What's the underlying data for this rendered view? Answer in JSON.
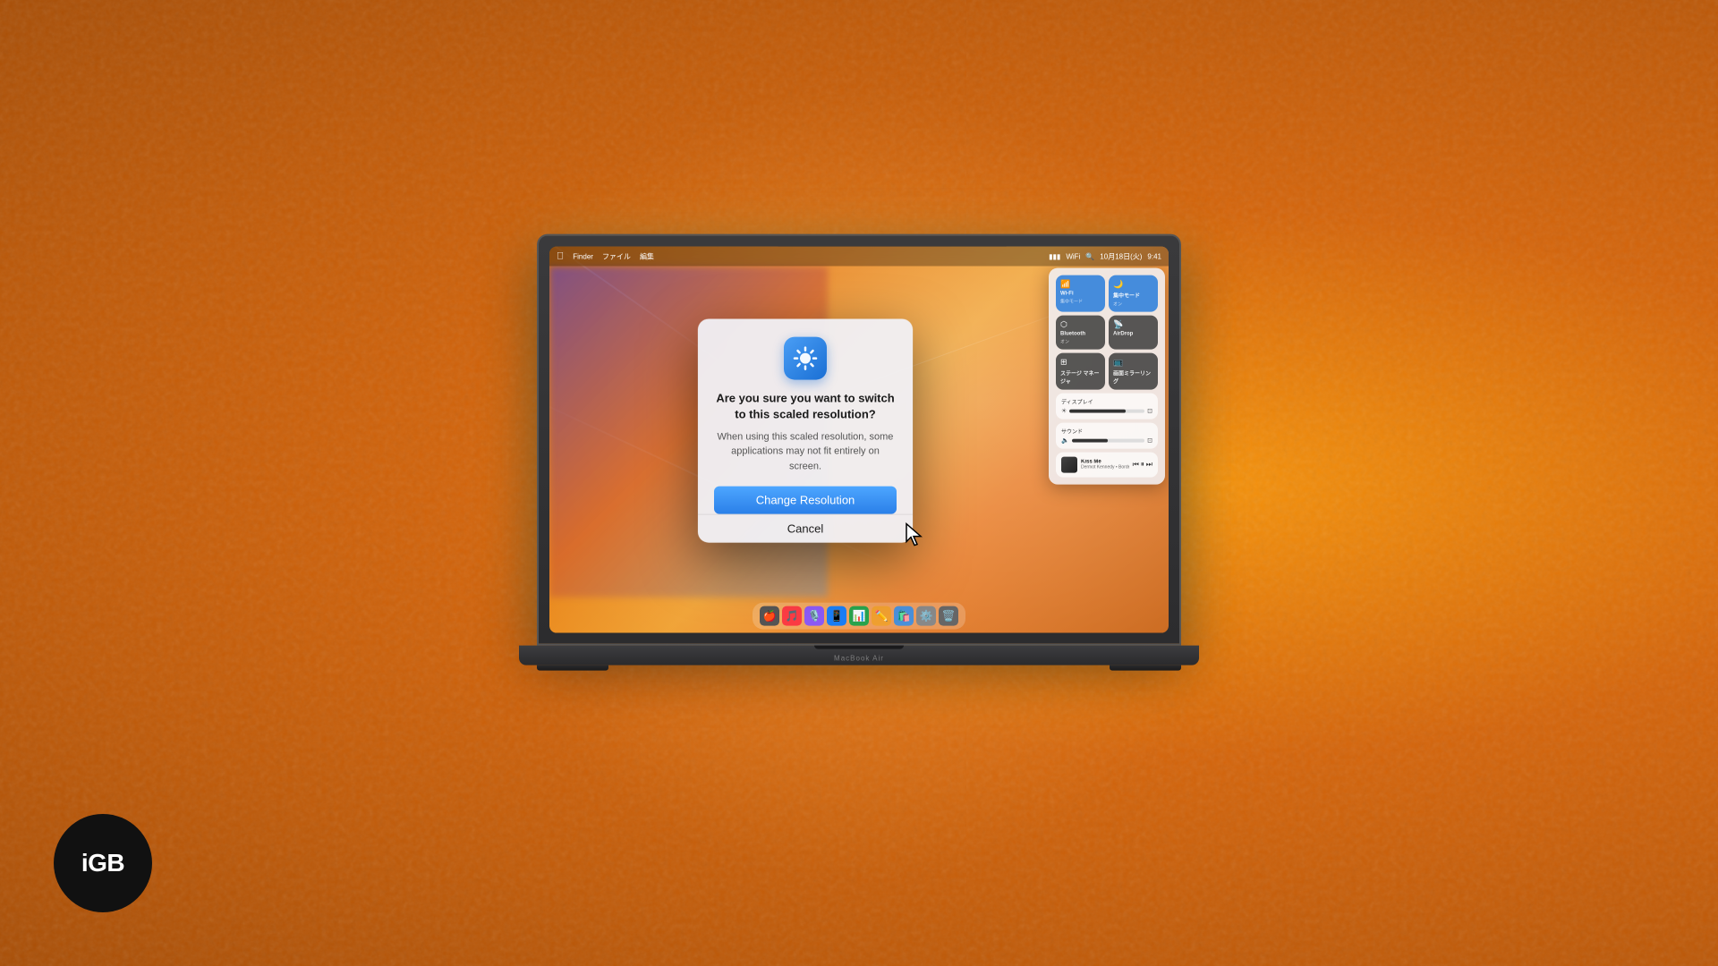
{
  "background": {
    "color_left": "#C86010",
    "color_right": "#F09030"
  },
  "igb_logo": {
    "text": "iGB"
  },
  "macbook": {
    "model_name": "MacBook Air"
  },
  "menubar": {
    "apple": "⌘",
    "time": "9:41",
    "date": "10月18日(火)"
  },
  "dialog": {
    "icon_alt": "Display Settings Icon",
    "title": "Are you sure you want to switch to this scaled resolution?",
    "body": "When using this scaled resolution, some applications may not fit entirely on screen.",
    "primary_button": "Change Resolution",
    "secondary_button": "Cancel"
  },
  "control_center": {
    "wifi_label": "Wi-Fi",
    "wifi_status": "集中モード",
    "bluetooth_label": "Bluetooth",
    "bluetooth_status": "オン",
    "airdrop_label": "AirDrop",
    "stage_label": "ステージ マネージャ",
    "mirror_label": "画面ミラーリング",
    "display_label": "ディスプレイ",
    "sound_label": "サウンド",
    "music_title": "Kiss Me",
    "music_artist": "Dermot Kennedy • Border"
  },
  "dock": {
    "icons": [
      "🍎",
      "🎵",
      "🎙️",
      "📱",
      "📊",
      "✏️",
      "🛍️",
      "⚙️",
      "🗑️"
    ]
  }
}
